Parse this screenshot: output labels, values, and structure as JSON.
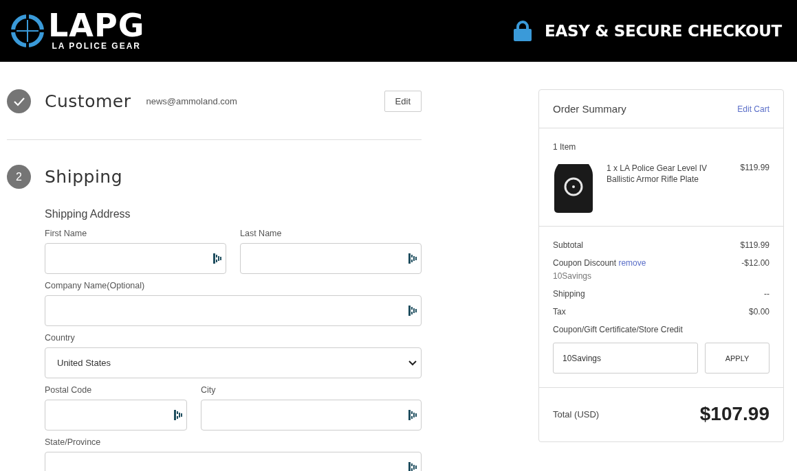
{
  "header": {
    "logo_text": "LAPG",
    "logo_tagline": "LA POLICE GEAR",
    "secure_label": "EASY & SECURE CHECKOUT"
  },
  "steps": [
    {
      "complete": true,
      "title": "Customer",
      "summary": "news@ammoland.com",
      "action": "Edit"
    },
    {
      "complete": false,
      "number": "2",
      "title": "Shipping",
      "section_title": "Shipping Address",
      "field_rows": [
        {
          "fields": [
            {
              "kind": "text",
              "label": "First Name"
            },
            {
              "kind": "text",
              "label": "Last Name"
            }
          ]
        },
        {
          "fields": [
            {
              "kind": "text",
              "label": "Company Name(Optional)"
            }
          ]
        },
        {
          "fields": [
            {
              "kind": "select",
              "label": "Country",
              "value": "United States"
            }
          ]
        },
        {
          "fields": [
            {
              "kind": "text",
              "label": "Postal Code"
            },
            {
              "kind": "text",
              "label": "City"
            }
          ]
        },
        {
          "fields": [
            {
              "kind": "text",
              "label": "State/Province"
            }
          ]
        }
      ]
    }
  ],
  "order_summary": {
    "title": "Order Summary",
    "edit_link": "Edit Cart",
    "item_count": "1 Item",
    "items": [
      {
        "kind": "picture",
        "description": "1 x LA Police Gear Level IV Ballistic Armor Rifle Plate",
        "price": "$119.99"
      }
    ],
    "lines": [
      {
        "label": "Subtotal",
        "value": "$119.99"
      },
      {
        "label": "Coupon Discount",
        "link": "remove",
        "note": "10Savings",
        "value": "-$12.00"
      },
      {
        "label": "Shipping",
        "value": "--"
      },
      {
        "label": "Tax",
        "value": "$0.00"
      }
    ],
    "coupon": {
      "label": "Coupon/Gift Certificate/Store Credit",
      "value": "10Savings",
      "button": "APPLY"
    },
    "total_label": "Total (USD)",
    "total_value": "$107.99"
  }
}
